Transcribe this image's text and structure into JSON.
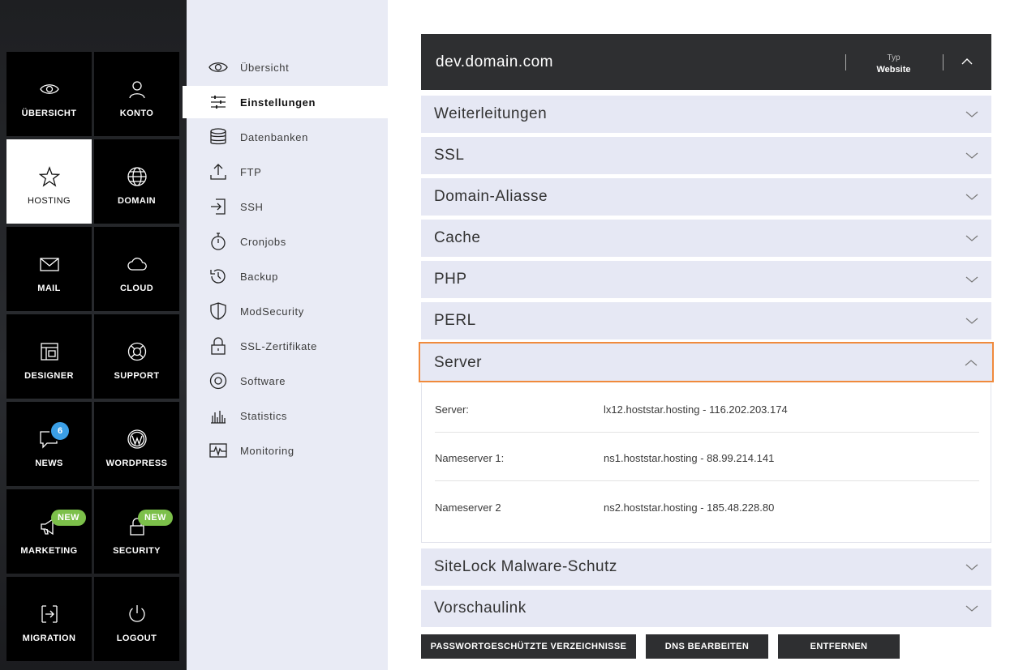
{
  "left_nav": {
    "tiles": [
      {
        "label": "ÜBERSICHT",
        "icon": "eye-icon"
      },
      {
        "label": "KONTO",
        "icon": "user-icon"
      },
      {
        "label": "HOSTING",
        "icon": "star-icon",
        "active": true
      },
      {
        "label": "DOMAIN",
        "icon": "globe-icon"
      },
      {
        "label": "MAIL",
        "icon": "envelope-icon"
      },
      {
        "label": "CLOUD",
        "icon": "cloud-icon"
      },
      {
        "label": "DESIGNER",
        "icon": "layout-icon"
      },
      {
        "label": "SUPPORT",
        "icon": "lifebuoy-icon"
      },
      {
        "label": "NEWS",
        "icon": "chat-icon",
        "badge": "6"
      },
      {
        "label": "WORDPRESS",
        "icon": "wordpress-icon"
      },
      {
        "label": "MARKETING",
        "icon": "megaphone-icon",
        "badge": "NEW"
      },
      {
        "label": "SECURITY",
        "icon": "lock-icon",
        "badge": "NEW"
      },
      {
        "label": "MIGRATION",
        "icon": "migration-icon"
      },
      {
        "label": "LOGOUT",
        "icon": "power-icon"
      }
    ],
    "accent_badge_color": "#3b9fe6",
    "new_badge_color": "#7cc04a"
  },
  "sub_nav": {
    "items": [
      {
        "label": "Übersicht",
        "icon": "eye-icon"
      },
      {
        "label": "Einstellungen",
        "icon": "sliders-icon",
        "active": true
      },
      {
        "label": "Datenbanken",
        "icon": "database-icon"
      },
      {
        "label": "FTP",
        "icon": "upload-icon"
      },
      {
        "label": "SSH",
        "icon": "login-icon"
      },
      {
        "label": "Cronjobs",
        "icon": "stopwatch-icon"
      },
      {
        "label": "Backup",
        "icon": "history-icon"
      },
      {
        "label": "ModSecurity",
        "icon": "shield-icon"
      },
      {
        "label": "SSL-Zertifikate",
        "icon": "padlock-icon"
      },
      {
        "label": "Software",
        "icon": "disc-icon"
      },
      {
        "label": "Statistics",
        "icon": "barchart-icon"
      },
      {
        "label": "Monitoring",
        "icon": "pulse-icon"
      }
    ]
  },
  "domain": {
    "name": "dev.domain.com",
    "type_label": "Typ",
    "type_value": "Website"
  },
  "accordion": [
    {
      "label": "Weiterleitungen"
    },
    {
      "label": "SSL"
    },
    {
      "label": "Domain-Aliasse"
    },
    {
      "label": "Cache"
    },
    {
      "label": "PHP"
    },
    {
      "label": "PERL"
    },
    {
      "label": "Server",
      "open": true
    },
    {
      "label": "SiteLock Malware-Schutz"
    },
    {
      "label": "Vorschaulink"
    }
  ],
  "server_details": [
    {
      "key": "Server:",
      "value": "lx12.hoststar.hosting - 116.202.203.174"
    },
    {
      "key": "Nameserver 1:",
      "value": "ns1.hoststar.hosting - 88.99.214.141"
    },
    {
      "key": "Nameserver 2",
      "value": "ns2.hoststar.hosting - 185.48.228.80"
    }
  ],
  "buttons": {
    "protected_dirs": "PASSWORTGESCHÜTZTE VERZEICHNISSE",
    "edit_dns": "DNS BEARBEITEN",
    "remove": "ENTFERNEN"
  },
  "highlight_color": "#f08a3c"
}
